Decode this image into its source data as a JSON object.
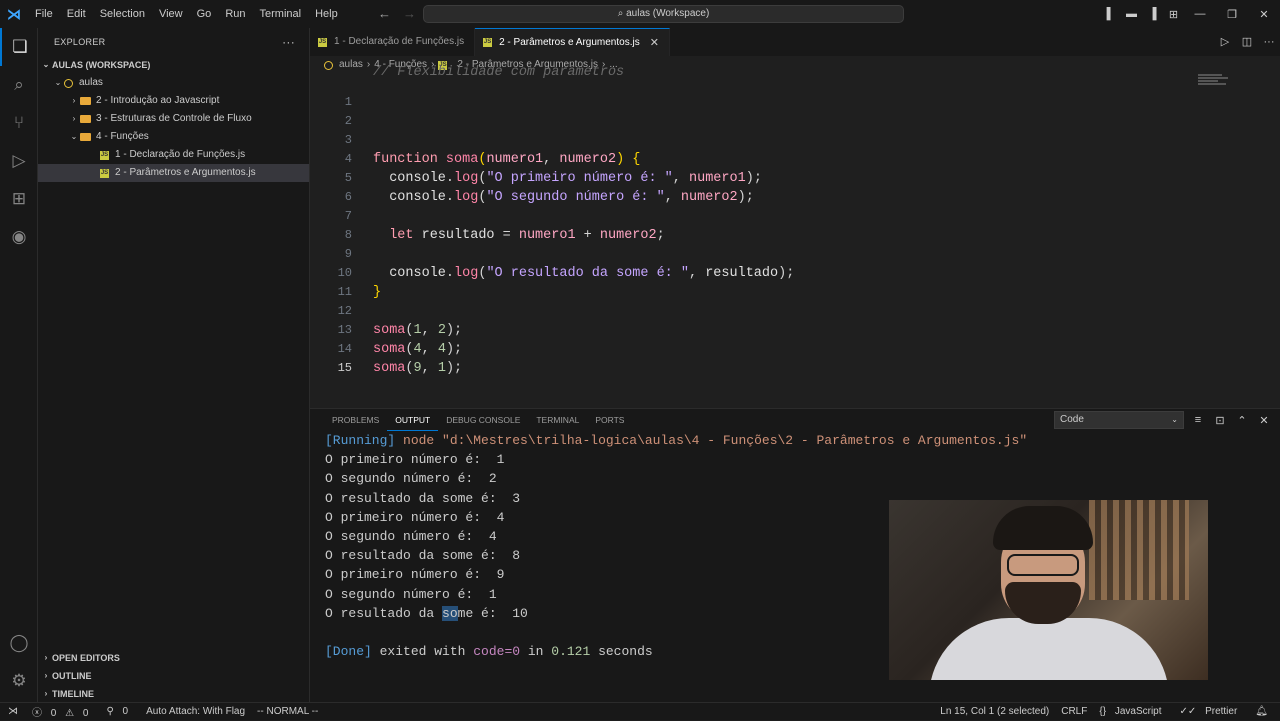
{
  "menu": [
    "File",
    "Edit",
    "Selection",
    "View",
    "Go",
    "Run",
    "Terminal",
    "Help"
  ],
  "command_center": "aulas (Workspace)",
  "explorer": {
    "title": "EXPLORER",
    "more": "···",
    "workspace": "AULAS (WORKSPACE)",
    "root": "aulas",
    "items": [
      {
        "label": "2 - Introdução ao Javascript",
        "type": "folder",
        "indent": 1
      },
      {
        "label": "3 - Estruturas de Controle de Fluxo",
        "type": "folder",
        "indent": 1
      },
      {
        "label": "4 - Funções",
        "type": "folder",
        "indent": 1
      },
      {
        "label": "1 - Declaração de Funções.js",
        "type": "file",
        "indent": 2
      },
      {
        "label": "2 - Parâmetros e Argumentos.js",
        "type": "file",
        "indent": 2
      }
    ],
    "bottom": [
      "OPEN EDITORS",
      "OUTLINE",
      "TIMELINE"
    ]
  },
  "tabs": [
    {
      "label": "1 - Declaração de Funções.js",
      "active": false
    },
    {
      "label": "2 - Parâmetros e Argumentos.js",
      "active": true
    }
  ],
  "breadcrumb": [
    "aulas",
    "4 - Funções",
    "2 - Parâmetros e Argumentos.js",
    "..."
  ],
  "code": {
    "comment": "// Flexibilidade com parâmetros",
    "line_numbers": [
      "1",
      "2",
      "3",
      "4",
      "5",
      "6",
      "7",
      "8",
      "9",
      "10",
      "11",
      "12",
      "13",
      "14",
      "15"
    ],
    "current_line": "15"
  },
  "panel": {
    "tabs": [
      "PROBLEMS",
      "OUTPUT",
      "DEBUG CONSOLE",
      "TERMINAL",
      "PORTS"
    ],
    "active_tab": "OUTPUT",
    "channel": "Code",
    "running_tag": "[Running]",
    "running_cmd": "node \"d:\\Mestres\\trilha-logica\\aulas\\4 - Funções\\2 - Parâmetros e Argumentos.js\"",
    "lines": [
      "O primeiro número é:  1",
      "O segundo número é:  2",
      "O resultado da some é:  3",
      "O primeiro número é:  4",
      "O segundo número é:  4",
      "O resultado da some é:  8",
      "O primeiro número é:  9",
      "O segundo número é:  1",
      "O resultado da some é:  10"
    ],
    "done_tag": "[Done]",
    "done_text_1": " exited with ",
    "done_code": "code=0",
    "done_text_2": " in ",
    "done_secs": "0.121",
    "done_text_3": " seconds"
  },
  "status": {
    "errors": "0",
    "warnings": "0",
    "ports": "0",
    "auto_attach": "Auto Attach: With Flag",
    "mode": "-- NORMAL --",
    "position": "Ln 15, Col 1 (2 selected)",
    "eol": "CRLF",
    "language": "JavaScript",
    "formatter": "Prettier"
  },
  "colors": {
    "accent": "#0078d4",
    "folder": "#e8a93a",
    "js": "#cbcb41"
  }
}
